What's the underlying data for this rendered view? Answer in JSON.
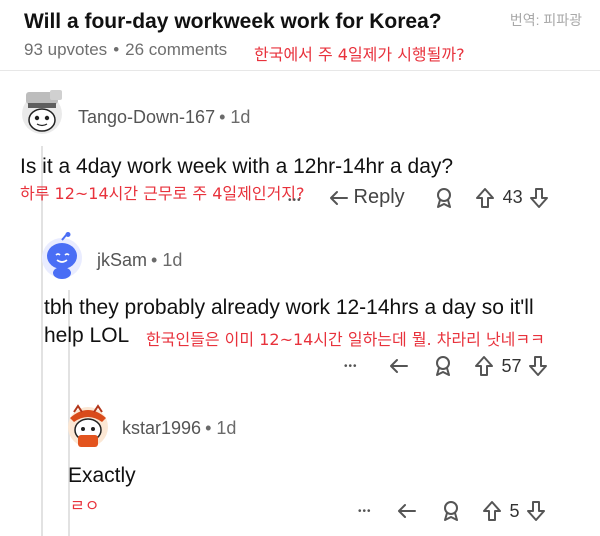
{
  "post": {
    "title": "Will a four-day workweek work for Korea?",
    "translator_credit": "번역: 피파광",
    "upvotes": "93 upvotes",
    "separator": "•",
    "comments": "26 comments",
    "title_translation": "한국에서 주 4일제가 시행될까?"
  },
  "comments": [
    {
      "username": "Tango-Down-167",
      "age": "• 1d",
      "text": "Is it a 4day work week with a 12hr-14hr a day?",
      "translation": "하루 12~14시간 근무로 주 4일제인거지?",
      "more": "•••",
      "reply_label": "Reply",
      "votes": "43"
    },
    {
      "username": "jkSam",
      "age": "• 1d",
      "text_line1": "tbh they probably already work 12-14hrs a day so it'll",
      "text_line2": "help LOL",
      "translation": "한국인들은 이미 12~14시간 일하는데 뭘. 차라리 낫네ㅋㅋ",
      "more": "•••",
      "votes": "57"
    },
    {
      "username": "kstar1996",
      "age": "• 1d",
      "text": "Exactly",
      "translation": "ㄹㅇ",
      "more": "•••",
      "votes": "5"
    }
  ],
  "colors": {
    "translation_red": "#e8323c",
    "snoo_blue": "#4a6ef5",
    "icon_gray": "#555555"
  }
}
